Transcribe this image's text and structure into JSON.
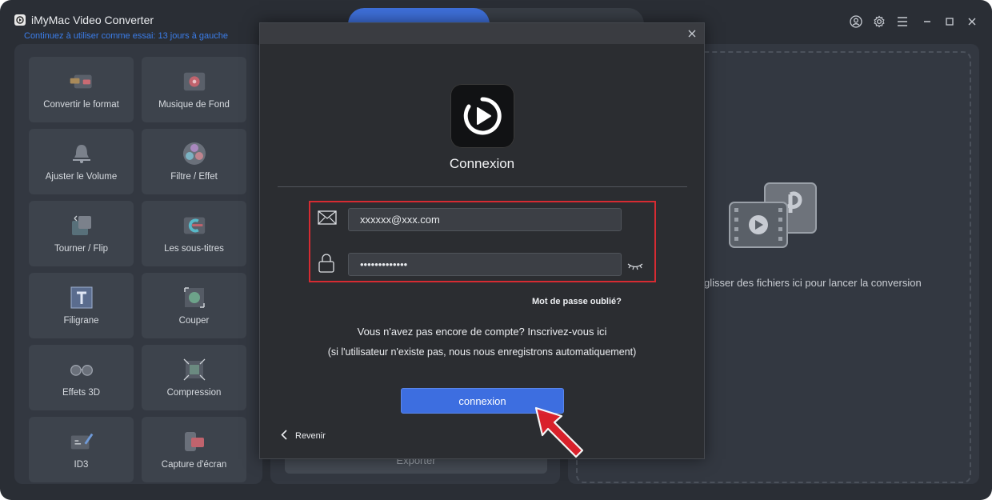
{
  "app": {
    "title": "iMyMac Video Converter",
    "trial_text": "Continuez à utiliser comme essai: 13 jours à gauche"
  },
  "sidebar": {
    "tools": [
      {
        "label": "Convertir le format",
        "icon": "convert-format-icon"
      },
      {
        "label": "Musique de Fond",
        "icon": "background-music-icon"
      },
      {
        "label": "Ajuster le Volume",
        "icon": "volume-bell-icon"
      },
      {
        "label": "Filtre / Effet",
        "icon": "filter-effect-icon"
      },
      {
        "label": "Tourner / Flip",
        "icon": "rotate-flip-icon"
      },
      {
        "label": "Les sous-titres",
        "icon": "subtitles-icon"
      },
      {
        "label": "Filigrane",
        "icon": "watermark-icon"
      },
      {
        "label": "Couper",
        "icon": "crop-icon"
      },
      {
        "label": "Effets 3D",
        "icon": "3d-glasses-icon"
      },
      {
        "label": "Compression",
        "icon": "compress-icon"
      },
      {
        "label": "ID3",
        "icon": "id3-edit-icon"
      },
      {
        "label": "Capture d'écran",
        "icon": "screen-capture-icon"
      }
    ]
  },
  "middle": {
    "export_label": "Exporter"
  },
  "dropzone": {
    "text": "glisser des fichiers ici pour lancer la conversion"
  },
  "modal": {
    "title": "Connexion",
    "email_value": "xxxxxx@xxx.com",
    "password_value": "•••••••••••••",
    "forgot_label": "Mot de passe oublié?",
    "no_account_text": "Vous n'avez pas encore de compte? Inscrivez-vous ici",
    "auto_register_note": "(si l'utilisateur n'existe pas, nous nous enregistrons automatiquement)",
    "login_button": "connexion",
    "back_label": "Revenir"
  },
  "colors": {
    "accent": "#3d6ee0",
    "highlight_border": "#d62b32",
    "arrow": "#e3212b"
  }
}
